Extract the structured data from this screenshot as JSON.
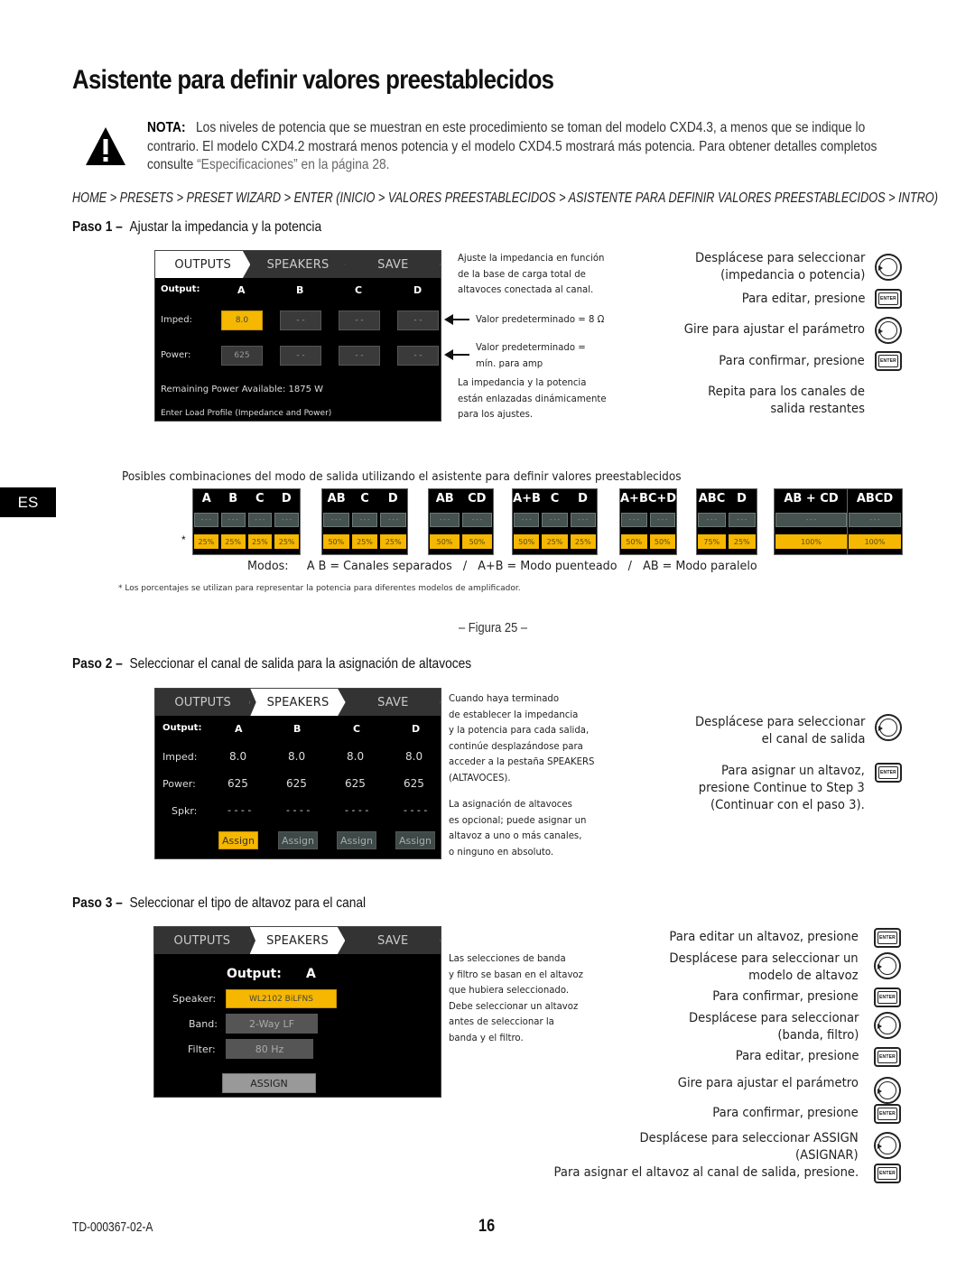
{
  "page": {
    "title": "Asistente para definir valores preestablecidos",
    "note_label": "NOTA:",
    "note_text": "Los niveles de potencia que se muestran en este procedimiento se toman del modelo CXD4.3, a menos que se indique lo contrario. El modelo CXD4.2 mostrará menos potencia y el modelo CXD4.5 mostrará más potencia. Para obtener detalles completos",
    "note_line3_prefix": "consulte",
    "note_ref": "“Especificaciones” en la página 28.",
    "breadcrumb": "HOME > PRESETS > PRESET WIZARD > ENTER (INICIO > VALORES PREESTABLECIDOS > ASISTENTE PARA DEFINIR VALORES PREESTABLECIDOS > INTRO)",
    "language_tab": "ES",
    "figure_caption": "– Figura 25 –",
    "doc_id": "TD-000367-02-A",
    "page_number": "16"
  },
  "tabs": {
    "outputs": "OUTPUTS",
    "speakers": "SPEAKERS",
    "save": "SAVE"
  },
  "step1": {
    "label": "Paso 1 –",
    "heading": "Ajustar la impedancia y la potencia",
    "screen": {
      "output_label": "Output:",
      "columns": [
        "A",
        "B",
        "C",
        "D"
      ],
      "imped_label": "Imped:",
      "imped_values": [
        "8.0",
        "- -",
        "- -",
        "- -"
      ],
      "power_label": "Power:",
      "power_values": [
        "625",
        "- -",
        "- -",
        "- -"
      ],
      "remaining": "Remaining Power Available:  1875 W",
      "hint": "Enter Load Profile (Impedance and Power)"
    },
    "notes": {
      "adjust": [
        "Ajuste la impedancia en función",
        "de la base de carga total de",
        "altavoces conectada al canal."
      ],
      "default_imped": "Valor predeterminado = 8 Ω",
      "default_power": [
        "Valor predeterminado =",
        "mín. para amp"
      ],
      "linked": [
        "La impedancia y la potencia",
        "están enlazadas dinámicamente",
        "para los ajustes."
      ]
    },
    "instructions": [
      {
        "text": [
          "Desplácese para seleccionar",
          "(impedancia o potencia)"
        ],
        "icon": "knob"
      },
      {
        "text": [
          "Para editar, presione"
        ],
        "icon": "enter"
      },
      {
        "text": [
          "Gire para ajustar el parámetro"
        ],
        "icon": "knob"
      },
      {
        "text": [
          "Para confirmar, presione"
        ],
        "icon": "enter"
      },
      {
        "text": [
          "Repita para los canales de",
          "salida restantes"
        ],
        "icon": ""
      }
    ]
  },
  "modes": {
    "caption": "Posibles combinaciones del modo de salida utilizando el asistente para definir valores preestablecidos",
    "asterisk": "*",
    "placeholder": "- - -",
    "items": [
      {
        "labels": [
          "A",
          "B",
          "C",
          "D"
        ],
        "percents": [
          "25%",
          "25%",
          "25%",
          "25%"
        ]
      },
      {
        "labels": [
          "AB",
          "C",
          "D"
        ],
        "percents": [
          "50%",
          "25%",
          "25%"
        ]
      },
      {
        "labels": [
          "AB",
          "CD"
        ],
        "percents": [
          "50%",
          "50%"
        ]
      },
      {
        "labels": [
          "A+B",
          "C",
          "D"
        ],
        "percents": [
          "50%",
          "25%",
          "25%"
        ]
      },
      {
        "labels": [
          "A+B",
          "C+D"
        ],
        "percents": [
          "50%",
          "50%"
        ]
      },
      {
        "labels": [
          "ABC",
          "D"
        ],
        "percents": [
          "75%",
          "25%"
        ]
      },
      {
        "labels": [
          "AB + CD"
        ],
        "percents": [
          "100%"
        ]
      },
      {
        "labels": [
          "ABCD"
        ],
        "percents": [
          "100%"
        ]
      }
    ],
    "legend": "Modos:     A B = Canales separados   /   A+B = Modo puenteado   /   AB = Modo paralelo",
    "footnote": "* Los porcentajes se utilizan para representar la potencia para diferentes modelos de amplificador."
  },
  "step2": {
    "label": "Paso 2 –",
    "heading": "Seleccionar el canal de salida para la asignación de altavoces",
    "screen": {
      "output_label": "Output:",
      "columns": [
        "A",
        "B",
        "C",
        "D"
      ],
      "imped_label": "Imped:",
      "imped_values": [
        "8.0",
        "8.0",
        "8.0",
        "8.0"
      ],
      "power_label": "Power:",
      "power_values": [
        "625",
        "625",
        "625",
        "625"
      ],
      "spkr_label": "Spkr:",
      "spkr_values": [
        "- - - -",
        "- - - -",
        "- - - -",
        "- - - -"
      ],
      "assign_label": "Assign"
    },
    "notes": [
      "Cuando haya terminado",
      "de establecer la impedancia",
      "y la potencia para cada salida,",
      "continúe desplazándose para",
      "acceder a la pestaña SPEAKERS",
      "(ALTAVOCES)."
    ],
    "notes2": [
      "La asignación de altavoces",
      "es opcional; puede asignar un",
      "altavoz a uno o más canales,",
      "o ninguno en absoluto."
    ],
    "instructions": [
      {
        "text": [
          "Desplácese para seleccionar",
          "el canal de salida"
        ],
        "icon": "knob"
      },
      {
        "text": [
          "Para asignar un altavoz,",
          "presione Continue to Step 3",
          "(Continuar con el paso 3)."
        ],
        "icon": "enter"
      }
    ]
  },
  "step3": {
    "label": "Paso 3 –",
    "heading": "Seleccionar el tipo de altavoz para el canal",
    "screen": {
      "output_label": "Output:",
      "output_value": "A",
      "speaker_label": "Speaker:",
      "speaker_value": "WL2102 BiLFNS",
      "band_label": "Band:",
      "band_value": "2-Way LF",
      "filter_label": "Filter:",
      "filter_value": "80 Hz",
      "assign_button": "ASSIGN"
    },
    "notes": [
      "Las selecciones de banda",
      "y filtro se basan en el altavoz",
      "que hubiera seleccionado.",
      "Debe seleccionar un altavoz",
      "antes de seleccionar la",
      "banda y el filtro."
    ],
    "instructions": [
      {
        "text": [
          "Para editar un altavoz, presione"
        ],
        "icon": "enter"
      },
      {
        "text": [
          "Desplácese para seleccionar un",
          "modelo de altavoz"
        ],
        "icon": "knob"
      },
      {
        "text": [
          "Para confirmar, presione"
        ],
        "icon": "enter"
      },
      {
        "text": [
          "Desplácese para seleccionar",
          "(banda, filtro)"
        ],
        "icon": "knob"
      },
      {
        "text": [
          "Para editar, presione"
        ],
        "icon": "enter"
      },
      {
        "text": [
          "Gire para ajustar el parámetro"
        ],
        "icon": "knob"
      },
      {
        "text": [
          "Para confirmar, presione"
        ],
        "icon": "enter"
      },
      {
        "text": [
          "Desplácese para seleccionar ASSIGN",
          "(ASIGNAR)"
        ],
        "icon": "knob"
      },
      {
        "text": [
          "Para asignar el altavoz al canal de salida, presione."
        ],
        "icon": "enter"
      }
    ]
  },
  "colors": {
    "highlight": "#f5b700",
    "screen_bg": "#000000",
    "cell_bg": "#3a3a3a",
    "mode_cell": "#46524f"
  }
}
